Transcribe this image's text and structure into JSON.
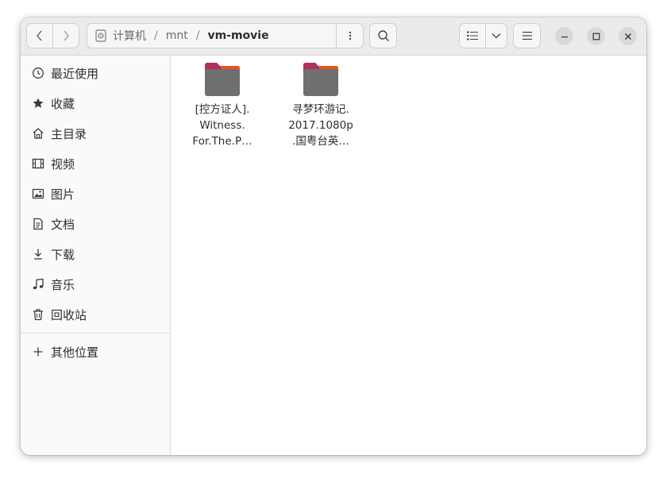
{
  "window": {
    "breadcrumb": [
      "计算机",
      "mnt",
      "vm-movie"
    ],
    "separator": "/"
  },
  "sidebar": {
    "items": [
      {
        "label": "最近使用",
        "icon": "clock-icon"
      },
      {
        "label": "收藏",
        "icon": "star-icon"
      },
      {
        "label": "主目录",
        "icon": "home-icon"
      },
      {
        "label": "视频",
        "icon": "film-icon"
      },
      {
        "label": "图片",
        "icon": "image-icon"
      },
      {
        "label": "文档",
        "icon": "document-icon"
      },
      {
        "label": "下载",
        "icon": "download-icon"
      },
      {
        "label": "音乐",
        "icon": "music-icon"
      },
      {
        "label": "回收站",
        "icon": "trash-icon"
      }
    ],
    "other": {
      "label": "其他位置",
      "icon": "plus-icon"
    }
  },
  "files": [
    {
      "name_lines": [
        "[控方证人].",
        "Witness.",
        "For.The.P…"
      ],
      "icon": "folder-icon"
    },
    {
      "name_lines": [
        "寻梦环游记.",
        "2017.1080p",
        ".国粤台英…"
      ],
      "icon": "folder-icon"
    }
  ],
  "colors": {
    "headerbar": "#ebebeb",
    "sidebar": "#fafafa",
    "folder_body": "#6f6f6f",
    "folder_tab": "#b0315a",
    "folder_tab_accent": "#e95420"
  }
}
